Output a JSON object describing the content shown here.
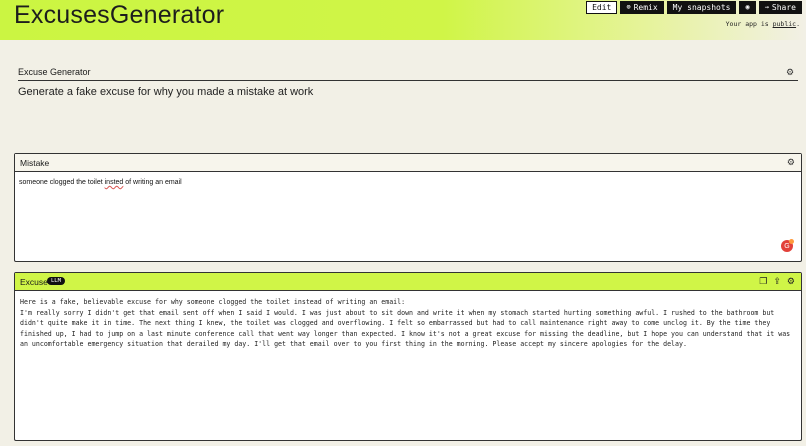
{
  "app": {
    "title": "ExcusesGenerator"
  },
  "toolbar": {
    "edit_label": "Edit",
    "remix_label": "Remix",
    "snapshots_label": "My snapshots",
    "share_label": "Share",
    "public_prefix": "Your app is ",
    "public_link": "public",
    "public_suffix": "."
  },
  "generator": {
    "label": "Excuse Generator",
    "description": "Generate a fake excuse for why you made a mistake at work"
  },
  "mistake": {
    "label": "Mistake",
    "value_before": "someone clogged the toilet ",
    "value_misspelled": "insted",
    "value_after": " of writing an email"
  },
  "excuse": {
    "label": "Excuse",
    "badge": "LLM",
    "output": "Here is a fake, believable excuse for why someone clogged the toilet instead of writing an email:\nI'm really sorry I didn't get that email sent off when I said I would. I was just about to sit down and write it when my stomach started hurting something awful. I rushed to the bathroom but didn't quite make it in time. The next thing I knew, the toilet was clogged and overflowing. I felt so embarrassed but had to call maintenance right away to come unclog it. By the time they finished up, I had to jump on a last minute conference call that went way longer than expected. I know it's not a great excuse for missing the deadline, but I hope you can understand that it was an uncomfortable emergency situation that derailed my day. I'll get that email over to you first thing in the morning. Please accept my sincere apologies for the delay."
  },
  "icons": {
    "remix": "remix-icon",
    "share": "share-arrow-icon",
    "camera": "camera-icon",
    "settings": "sliders-icon",
    "copy": "copy-icon",
    "export": "export-icon"
  },
  "colors": {
    "accent": "#cbf542",
    "background": "#f2f0e6",
    "dark": "#111111"
  }
}
